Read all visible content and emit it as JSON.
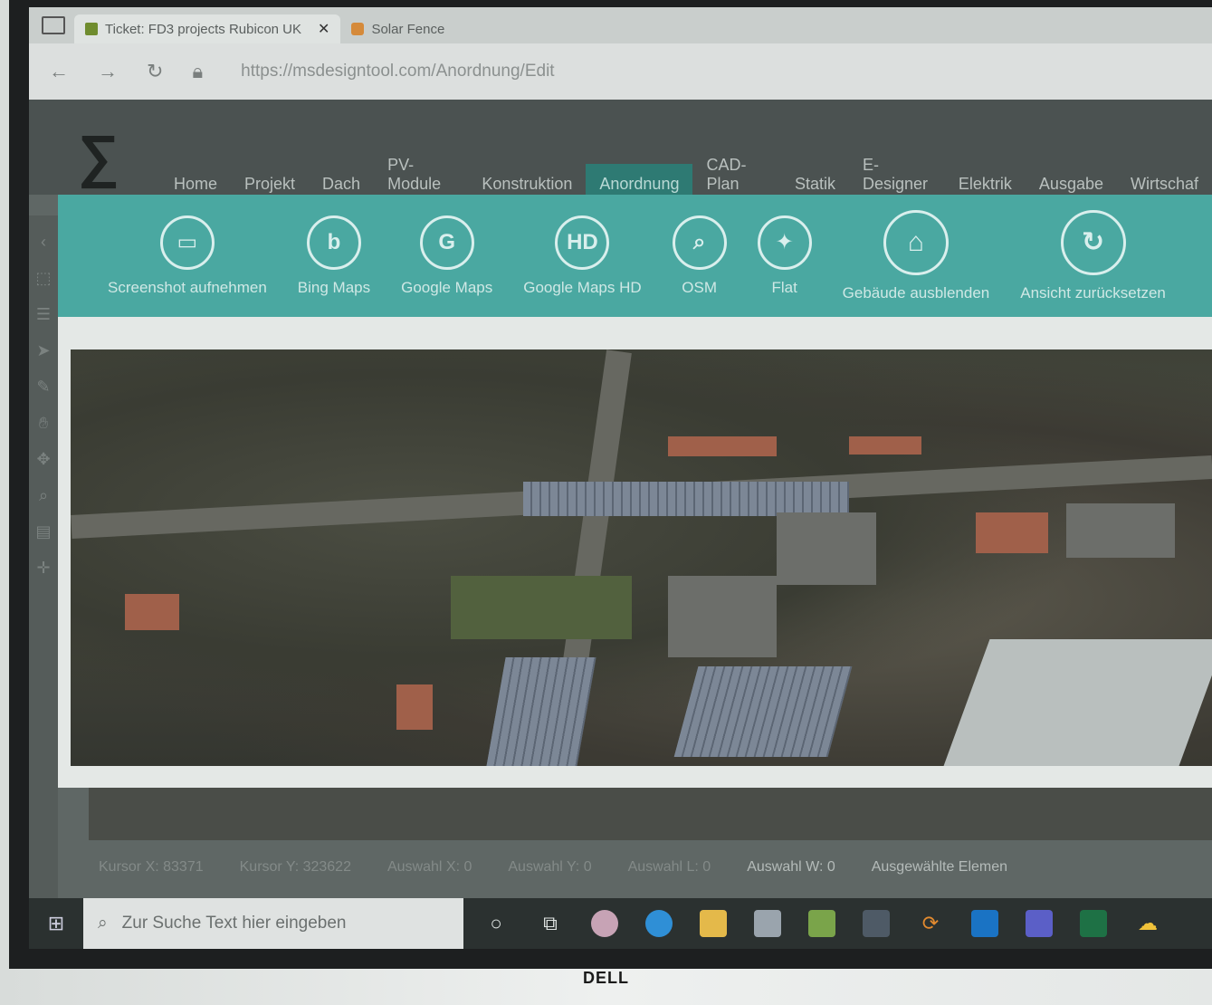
{
  "browser": {
    "tab_title": "Ticket: FD3 projects Rubicon UK",
    "tab_close": "✕",
    "tab2_title": "Solar Fence",
    "url": "https://msdesigntool.com/Anordnung/Edit"
  },
  "app": {
    "logo": "∑",
    "menu": [
      {
        "label": "Home"
      },
      {
        "label": "Projekt"
      },
      {
        "label": "Dach"
      },
      {
        "label": "PV-Module"
      },
      {
        "label": "Konstruktion"
      },
      {
        "label": "Anordnung"
      },
      {
        "label": "CAD-Plan"
      },
      {
        "label": "Statik"
      },
      {
        "label": "E-Designer"
      },
      {
        "label": "Elektrik"
      },
      {
        "label": "Ausgabe"
      },
      {
        "label": "Wirtschaf"
      }
    ],
    "ribbon": [
      {
        "label": "Screenshot aufnehmen",
        "icon": "monitor-icon",
        "glyph": "▭"
      },
      {
        "label": "Bing Maps",
        "icon": "bing-icon",
        "glyph": "b"
      },
      {
        "label": "Google Maps",
        "icon": "google-maps-icon",
        "glyph": "G"
      },
      {
        "label": "Google Maps HD",
        "icon": "hd-icon",
        "glyph": "HD"
      },
      {
        "label": "OSM",
        "icon": "osm-search-icon",
        "glyph": "⌕"
      },
      {
        "label": "Flat",
        "icon": "satellite-icon",
        "glyph": "✦"
      },
      {
        "label": "Gebäude ausblenden",
        "icon": "house-icon",
        "glyph": "⌂"
      },
      {
        "label": "Ansicht zurücksetzen",
        "icon": "reset-icon",
        "glyph": "↻"
      }
    ]
  },
  "statusbar": {
    "kursor_x": "Kursor X: 83371",
    "kursor_y": "Kursor Y: 323622",
    "auswahl_x": "Auswahl X: 0",
    "auswahl_y": "Auswahl Y: 0",
    "auswahl_l": "Auswahl L: 0",
    "auswahl_w": "Auswahl W: 0",
    "selected": "Ausgewählte Elemen"
  },
  "taskbar": {
    "search_placeholder": "Zur Suche Text hier eingeben"
  },
  "monitor_brand": "DELL",
  "colors": {
    "ribbon": "#4aa8a1",
    "active_tab": "#2e7a73",
    "header": "#4b5251"
  }
}
